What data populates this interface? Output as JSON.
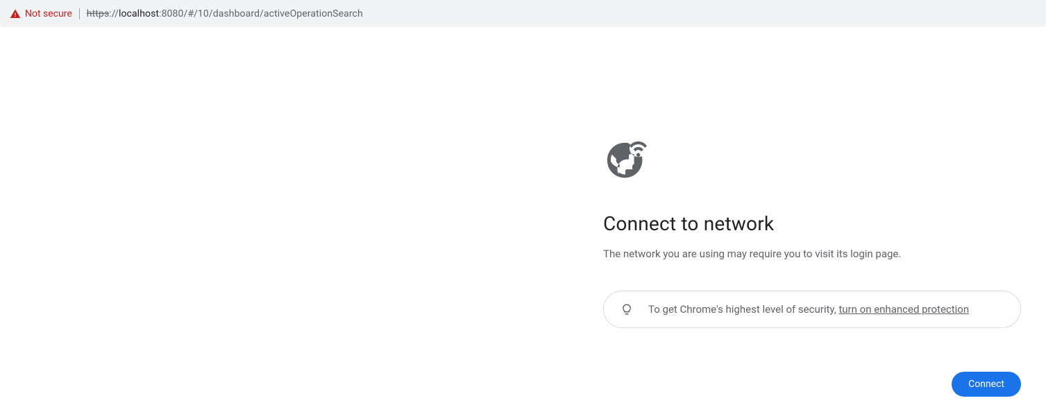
{
  "addressBar": {
    "notSecure": "Not secure",
    "urlScheme": "https",
    "urlSep": "://",
    "urlHost": "localhost",
    "urlRest": ":8080/#/10/dashboard/activeOperationSearch"
  },
  "page": {
    "title": "Connect to network",
    "subtitle": "The network you are using may require you to visit its login page.",
    "tipPrefix": "To get Chrome's highest level of security, ",
    "tipLink": "turn on enhanced protection",
    "connectLabel": "Connect"
  }
}
